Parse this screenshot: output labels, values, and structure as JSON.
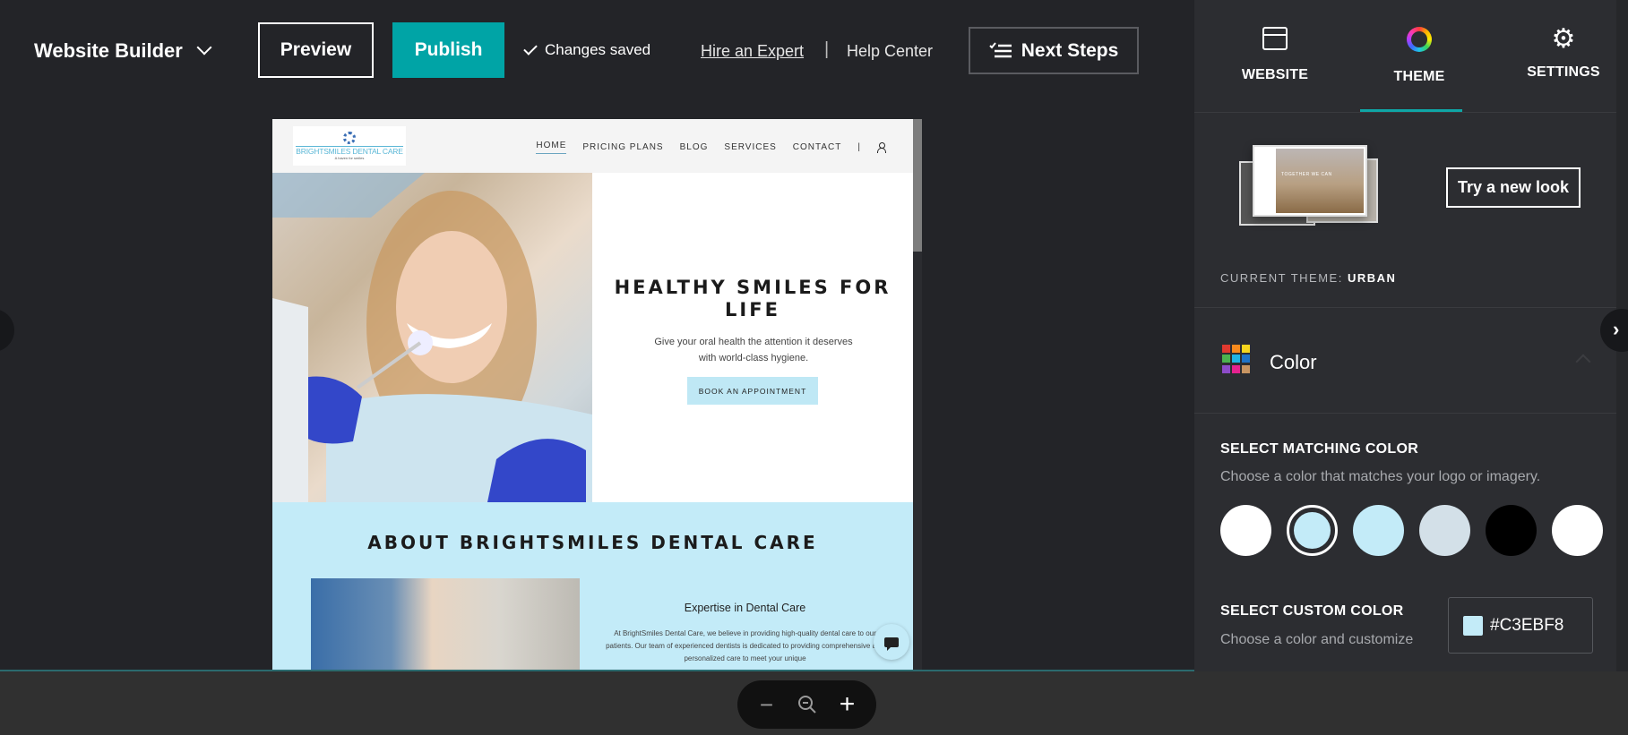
{
  "topbar": {
    "brand": "Website Builder",
    "preview_label": "Preview",
    "publish_label": "Publish",
    "saved_status": "Changes saved",
    "hire_link": "Hire an Expert",
    "separator": "|",
    "help_link": "Help Center",
    "next_steps_label": "Next Steps"
  },
  "site": {
    "logo_name": "BRIGHTSMILES DENTAL CARE",
    "logo_tagline": "A haven for smiles",
    "nav": [
      "HOME",
      "PRICING PLANS",
      "BLOG",
      "SERVICES",
      "CONTACT"
    ],
    "nav_active": "HOME",
    "nav_divider": "|",
    "hero_title": "HEALTHY SMILES FOR LIFE",
    "hero_subtitle": "Give your oral health the attention it deserves with world-class hygiene.",
    "hero_button": "BOOK AN APPOINTMENT",
    "about_title": "ABOUT BRIGHTSMILES DENTAL CARE",
    "about_heading": "Expertise in Dental Care",
    "about_text": "At BrightSmiles Dental Care, we believe in providing high-quality dental care to our patients. Our team of experienced dentists is dedicated to providing comprehensive and personalized care to meet your unique"
  },
  "panel": {
    "tabs": [
      {
        "label": "WEBSITE",
        "icon": "browser-window-icon"
      },
      {
        "label": "THEME",
        "icon": "color-wheel-icon"
      },
      {
        "label": "SETTINGS",
        "icon": "gear-icon"
      }
    ],
    "active_tab": "THEME",
    "theme_thumb_text": "TOGETHER WE CAN",
    "try_new_look": "Try a new look",
    "current_theme_label": "CURRENT THEME:",
    "current_theme_value": "URBAN",
    "color_section_title": "Color",
    "matching_heading": "SELECT MATCHING COLOR",
    "matching_desc": "Choose a color that matches your logo or imagery.",
    "swatches": [
      "#FFFFFF",
      "#C3EBF8",
      "#C3EBF8",
      "#D3E0E8",
      "#000000",
      "#FFFFFF"
    ],
    "selected_swatch_index": 1,
    "custom_heading": "SELECT CUSTOM COLOR",
    "custom_desc": "Choose a color and customize",
    "custom_hex": "#C3EBF8",
    "palette_colors": [
      "#e0392f",
      "#f78a1d",
      "#f7d51d",
      "#4cb34f",
      "#1fb4e3",
      "#1f73c7",
      "#8d4cc9",
      "#e6228f",
      "#c89562"
    ]
  },
  "colors": {
    "accent": "#00A4A6",
    "site_accent": "#C3EBF8"
  },
  "zoom_controls": {
    "zoom_out": "−",
    "zoom_in": "+"
  }
}
